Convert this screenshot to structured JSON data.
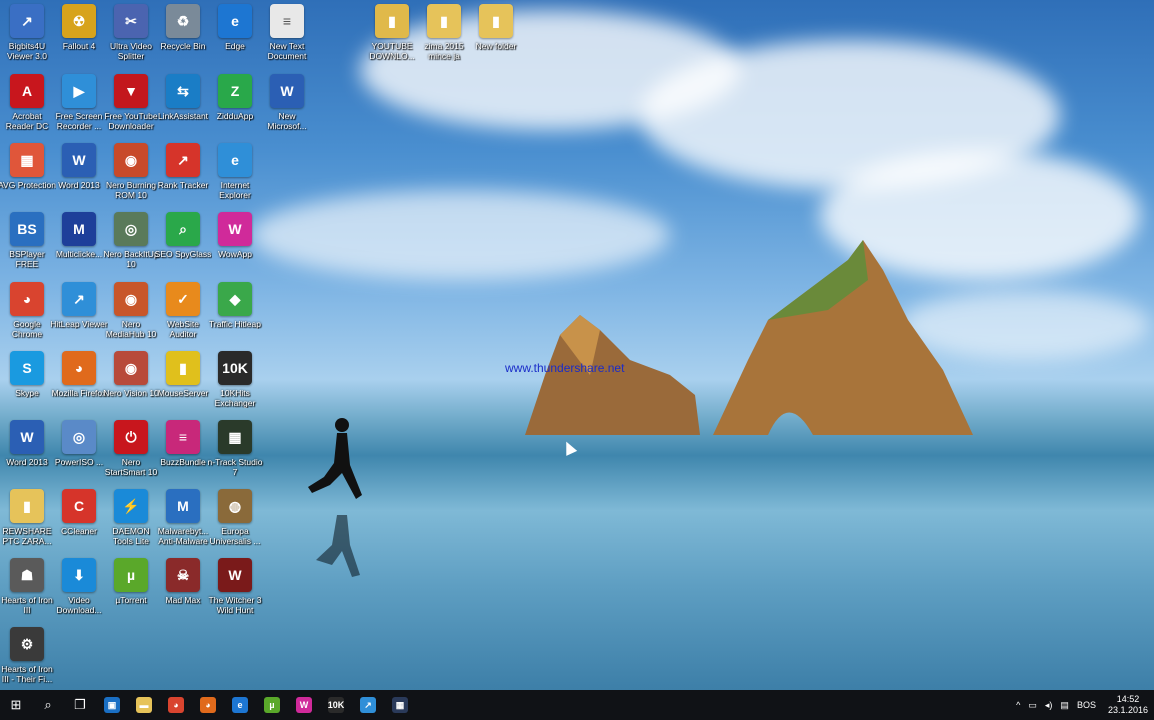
{
  "desktop": {
    "watermark": "www.thundershare.net",
    "icons": [
      {
        "label": "Bigbits4U Viewer 3.0",
        "glyph": "↗",
        "color": "#3a6fc4"
      },
      {
        "label": "Fallout 4",
        "glyph": "☢",
        "color": "#d7a31c"
      },
      {
        "label": "Ultra Video Splitter",
        "glyph": "✂",
        "color": "#4b64b0"
      },
      {
        "label": "Recycle Bin",
        "glyph": "♻",
        "color": "#7a8a99"
      },
      {
        "label": "Edge",
        "glyph": "e",
        "color": "#1d76d2"
      },
      {
        "label": "New Text Document",
        "glyph": "≡",
        "color": "#e8e8e8"
      },
      {
        "label": "YOUTUBE DOWNLO...",
        "glyph": "▮",
        "color": "#e0b94a"
      },
      {
        "label": "zima 2015 mince ja",
        "glyph": "▮",
        "color": "#e6c35a"
      },
      {
        "label": "New folder",
        "glyph": "▮",
        "color": "#e6c35a"
      },
      {
        "label": "Acrobat Reader DC",
        "glyph": "A",
        "color": "#c8161d"
      },
      {
        "label": "Free Screen Recorder ...",
        "glyph": "▶",
        "color": "#2f8fd8"
      },
      {
        "label": "Free YouTube Downloader",
        "glyph": "▼",
        "color": "#c3171d"
      },
      {
        "label": "LinkAssistant",
        "glyph": "⇆",
        "color": "#1a7dc6"
      },
      {
        "label": "ZidduApp",
        "glyph": "Z",
        "color": "#29a84a"
      },
      {
        "label": "New Microsof...",
        "glyph": "W",
        "color": "#2b5fb4"
      },
      {
        "label": "AVG Protection",
        "glyph": "▦",
        "color": "#e0563a"
      },
      {
        "label": "Word 2013",
        "glyph": "W",
        "color": "#2b5fb4"
      },
      {
        "label": "Nero Burning ROM 10",
        "glyph": "◉",
        "color": "#c84a2a"
      },
      {
        "label": "Rank Tracker",
        "glyph": "↗",
        "color": "#d6342a"
      },
      {
        "label": "Internet Explorer",
        "glyph": "e",
        "color": "#2f8fd8"
      },
      {
        "label": "BSPlayer FREE",
        "glyph": "BS",
        "color": "#2a6fc0"
      },
      {
        "label": "Multiclicke...",
        "glyph": "M",
        "color": "#1e3f9a"
      },
      {
        "label": "Nero BackItUp 10",
        "glyph": "◎",
        "color": "#5a7a5a"
      },
      {
        "label": "SEO SpyGlass",
        "glyph": "⌕",
        "color": "#2aa84a"
      },
      {
        "label": "WowApp",
        "glyph": "W",
        "color": "#d02a9a"
      },
      {
        "label": "Google Chrome",
        "glyph": "◕",
        "color": "#d9442f"
      },
      {
        "label": "HitLeap Viewer",
        "glyph": "↗",
        "color": "#2f8fd8"
      },
      {
        "label": "Nero MediaHub 10",
        "glyph": "◉",
        "color": "#c8562a"
      },
      {
        "label": "WebSite Auditor",
        "glyph": "✓",
        "color": "#e88a1c"
      },
      {
        "label": "Traffic Hitleap",
        "glyph": "◆",
        "color": "#3aa84a"
      },
      {
        "label": "Skype",
        "glyph": "S",
        "color": "#1a9ae0"
      },
      {
        "label": "Mozilla Firefox",
        "glyph": "◕",
        "color": "#e06a1c"
      },
      {
        "label": "Nero Vision 10",
        "glyph": "◉",
        "color": "#b84a3a"
      },
      {
        "label": "MouseServer",
        "glyph": "▮",
        "color": "#e0c01c"
      },
      {
        "label": "10KHits Exchanger",
        "glyph": "10K",
        "color": "#2a2a2a"
      },
      {
        "label": "Word 2013",
        "glyph": "W",
        "color": "#2b5fb4"
      },
      {
        "label": "PowerISO ...",
        "glyph": "◎",
        "color": "#5a8ac8"
      },
      {
        "label": "Nero StartSmart 10",
        "glyph": "⏻",
        "color": "#c8161d"
      },
      {
        "label": "BuzzBundle",
        "glyph": "≡",
        "color": "#c8287a"
      },
      {
        "label": "n-Track Studio 7",
        "glyph": "▦",
        "color": "#2a3a2a"
      },
      {
        "label": "REWSHARE PTC ZARA...",
        "glyph": "▮",
        "color": "#e6c35a"
      },
      {
        "label": "CCleaner",
        "glyph": "C",
        "color": "#d6342a"
      },
      {
        "label": "DAEMON Tools Lite",
        "glyph": "⚡",
        "color": "#1a8ad8"
      },
      {
        "label": "Malwarebyt... Anti-Malware",
        "glyph": "M",
        "color": "#2a6fc0"
      },
      {
        "label": "Europa Universalis ...",
        "glyph": "◍",
        "color": "#8a6a3a"
      },
      {
        "label": "Hearts of Iron III",
        "glyph": "☗",
        "color": "#5a5a5a"
      },
      {
        "label": "Video Download...",
        "glyph": "⬇",
        "color": "#1a8ad8"
      },
      {
        "label": "µTorrent",
        "glyph": "µ",
        "color": "#5aa82a"
      },
      {
        "label": "Mad Max",
        "glyph": "☠",
        "color": "#8a2a2a"
      },
      {
        "label": "The Witcher 3 Wild Hunt",
        "glyph": "W",
        "color": "#7a1a1a"
      },
      {
        "label": "Hearts of Iron III - Their Fi...",
        "glyph": "⚙",
        "color": "#3a3a3a"
      }
    ]
  },
  "taskbar": {
    "start_glyph": "⊞",
    "search_glyph": "⌕",
    "taskview_glyph": "❐",
    "pinned": [
      {
        "glyph": "▣",
        "color": "#1a6fc4"
      },
      {
        "glyph": "▬",
        "color": "#e6c35a"
      },
      {
        "glyph": "◕",
        "color": "#d9442f"
      },
      {
        "glyph": "◕",
        "color": "#e06a1c"
      },
      {
        "glyph": "e",
        "color": "#1d76d2"
      },
      {
        "glyph": "µ",
        "color": "#5aa82a"
      },
      {
        "glyph": "W",
        "color": "#d02a9a"
      },
      {
        "glyph": "10K",
        "color": "#2a2a2a"
      },
      {
        "glyph": "↗",
        "color": "#2f8fd8"
      },
      {
        "glyph": "▦",
        "color": "#2a3a5a"
      }
    ],
    "tray": {
      "chevron": "^",
      "lang": "BOS",
      "time": "14:52",
      "date": "23.1.2016"
    }
  }
}
